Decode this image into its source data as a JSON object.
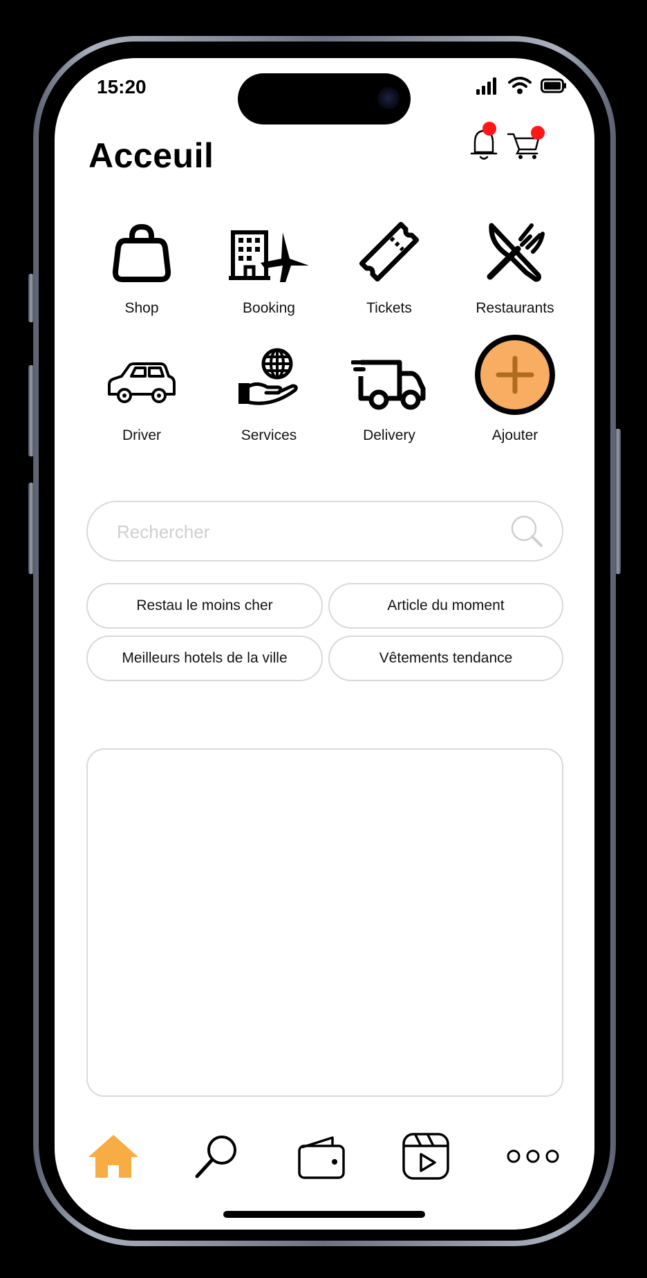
{
  "status_bar": {
    "time": "15:20"
  },
  "header": {
    "title": "Acceuil"
  },
  "categories": [
    {
      "label": "Shop",
      "icon": "shopping-bag-icon"
    },
    {
      "label": "Booking",
      "icon": "hotel-plane-icon"
    },
    {
      "label": "Tickets",
      "icon": "ticket-icon"
    },
    {
      "label": "Restaurants",
      "icon": "knife-fork-icon"
    },
    {
      "label": "Driver",
      "icon": "car-icon"
    },
    {
      "label": "Services",
      "icon": "globe-hand-icon"
    },
    {
      "label": "Delivery",
      "icon": "truck-icon"
    },
    {
      "label": "Ajouter",
      "icon": "plus-icon"
    }
  ],
  "search": {
    "placeholder": "Rechercher",
    "value": ""
  },
  "chips": [
    "Restau le moins cher",
    "Article du moment",
    "Meilleurs hotels de la ville",
    "Vêtements tendance"
  ],
  "tabbar": {
    "items": [
      {
        "icon": "home-icon",
        "active": true
      },
      {
        "icon": "search-icon"
      },
      {
        "icon": "wallet-icon"
      },
      {
        "icon": "video-clapper-icon"
      },
      {
        "icon": "more-icon"
      }
    ]
  },
  "colors": {
    "accent": "#F7AC44",
    "add_fill": "#F8AD62",
    "badge": "#FF1717",
    "border": "#D9D9D9"
  }
}
